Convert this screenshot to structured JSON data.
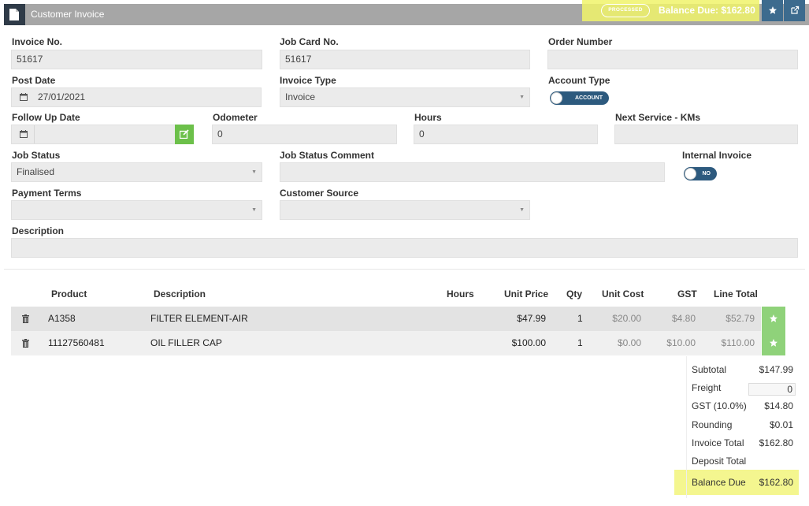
{
  "header": {
    "title": "Customer Invoice",
    "status_badge": "PROCESSED",
    "balance_due": "Balance Due: $162.80",
    "icons": [
      "document-icon",
      "star-icon",
      "external-link-icon"
    ]
  },
  "form": {
    "invoice_no": {
      "label": "Invoice No.",
      "value": "51617"
    },
    "job_card_no": {
      "label": "Job Card No.",
      "value": "51617"
    },
    "order_number": {
      "label": "Order Number",
      "value": ""
    },
    "post_date": {
      "label": "Post Date",
      "value": "27/01/2021"
    },
    "invoice_type": {
      "label": "Invoice Type",
      "value": "Invoice"
    },
    "account_type": {
      "label": "Account Type",
      "toggle": "ACCOUNT"
    },
    "follow_up_date": {
      "label": "Follow Up Date",
      "value": ""
    },
    "odometer": {
      "label": "Odometer",
      "value": "0"
    },
    "hours": {
      "label": "Hours",
      "value": "0"
    },
    "next_service": {
      "label": "Next Service - KMs",
      "value": ""
    },
    "job_status": {
      "label": "Job Status",
      "value": "Finalised"
    },
    "job_status_comment": {
      "label": "Job Status Comment",
      "value": ""
    },
    "internal_invoice": {
      "label": "Internal Invoice",
      "toggle": "NO"
    },
    "payment_terms": {
      "label": "Payment Terms",
      "value": ""
    },
    "customer_source": {
      "label": "Customer Source",
      "value": ""
    },
    "description": {
      "label": "Description",
      "value": ""
    }
  },
  "table": {
    "headers": {
      "product": "Product",
      "description": "Description",
      "hours": "Hours",
      "unit_price": "Unit Price",
      "qty": "Qty",
      "unit_cost": "Unit Cost",
      "gst": "GST",
      "line_total": "Line Total"
    },
    "rows": [
      {
        "product": "A1358",
        "description": "FILTER ELEMENT-AIR",
        "hours": "",
        "unit_price": "$47.99",
        "qty": "1",
        "unit_cost": "$20.00",
        "gst": "$4.80",
        "line_total": "$52.79"
      },
      {
        "product": "11127560481",
        "description": "OIL FILLER CAP",
        "hours": "",
        "unit_price": "$100.00",
        "qty": "1",
        "unit_cost": "$0.00",
        "gst": "$10.00",
        "line_total": "$110.00"
      }
    ]
  },
  "totals": {
    "subtotal": {
      "label": "Subtotal",
      "value": "$147.99"
    },
    "freight": {
      "label": "Freight",
      "value": "0"
    },
    "gst": {
      "label": "GST (10.0%)",
      "value": "$14.80"
    },
    "rounding": {
      "label": "Rounding",
      "value": "$0.01"
    },
    "invoice_total": {
      "label": "Invoice Total",
      "value": "$162.80"
    },
    "deposit_total": {
      "label": "Deposit Total",
      "value": ""
    },
    "balance_due": {
      "label": "Balance Due",
      "value": "$162.80"
    }
  },
  "colors": {
    "header_bg": "#a6a6a6",
    "accent_blue": "#2d5a7e",
    "green": "#6cc04a",
    "highlight": "#f0f36a"
  }
}
